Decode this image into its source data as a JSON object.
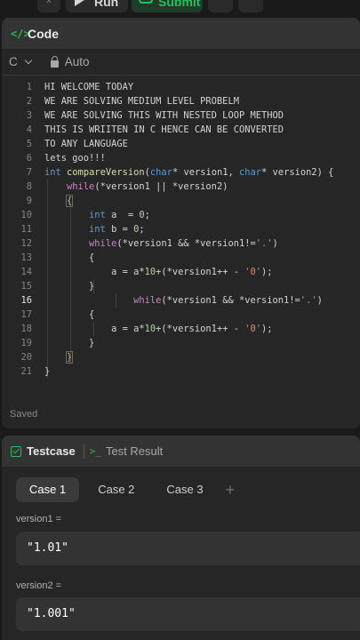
{
  "toolbar": {
    "run_label": "Run",
    "submit_label": "Submit",
    "x_label": "x"
  },
  "code_panel": {
    "title": "Code",
    "language": "C",
    "mode": "Auto",
    "status": "Saved",
    "active_line": 16
  },
  "test_panel": {
    "tabs": [
      "Testcase",
      "Test Result"
    ],
    "cases": [
      "Case 1",
      "Case 2",
      "Case 3"
    ],
    "active_case": 0,
    "inputs": [
      {
        "label": "version1 =",
        "value": "\"1.01\""
      },
      {
        "label": "version2 =",
        "value": "\"1.001\""
      }
    ]
  },
  "colors": {
    "accent": "#2cbb5d",
    "keyword": "#569cd6",
    "string": "#ce9178",
    "number": "#b5cea8"
  }
}
